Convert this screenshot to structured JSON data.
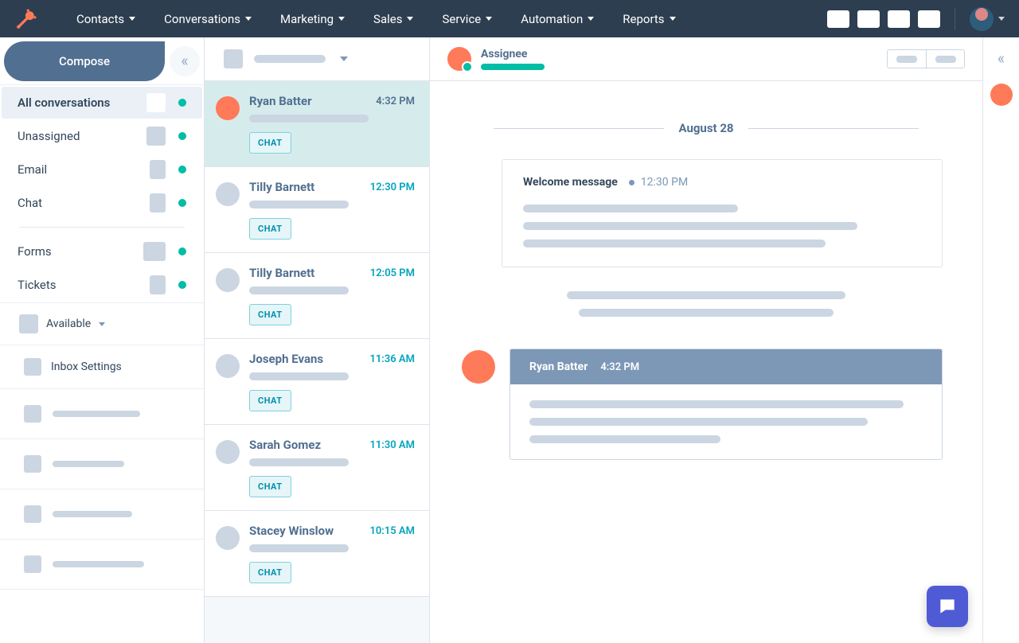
{
  "nav": {
    "items": [
      "Contacts",
      "Conversations",
      "Marketing",
      "Sales",
      "Service",
      "Automation",
      "Reports"
    ]
  },
  "compose_label": "Compose",
  "filters": {
    "all": "All conversations",
    "unassigned": "Unassigned",
    "email": "Email",
    "chat": "Chat",
    "forms": "Forms",
    "tickets": "Tickets"
  },
  "availability_label": "Available",
  "inbox_settings_label": "Inbox Settings",
  "conversations": [
    {
      "name": "Ryan Batter",
      "time": "4:32 PM",
      "badge": "CHAT",
      "unread": false,
      "avatar": "orange",
      "selected": true,
      "preview_w": 150
    },
    {
      "name": "Tilly Barnett",
      "time": "12:30 PM",
      "badge": "CHAT",
      "unread": true,
      "avatar": "grey",
      "selected": false,
      "preview_w": 125
    },
    {
      "name": "Tilly Barnett",
      "time": "12:05 PM",
      "badge": "CHAT",
      "unread": true,
      "avatar": "grey",
      "selected": false,
      "preview_w": 125
    },
    {
      "name": "Joseph Evans",
      "time": "11:36 AM",
      "badge": "CHAT",
      "unread": true,
      "avatar": "grey",
      "selected": false,
      "preview_w": 125
    },
    {
      "name": "Sarah Gomez",
      "time": "11:30 AM",
      "badge": "CHAT",
      "unread": true,
      "avatar": "grey",
      "selected": false,
      "preview_w": 125
    },
    {
      "name": "Stacey Winslow",
      "time": "10:15 AM",
      "badge": "CHAT",
      "unread": true,
      "avatar": "grey",
      "selected": false,
      "preview_w": 125
    }
  ],
  "thread": {
    "assignee_label": "Assignee",
    "date_label": "August 28",
    "welcome_title": "Welcome message",
    "welcome_time": "12:30 PM",
    "reply_name": "Ryan Batter",
    "reply_time": "4:32 PM"
  },
  "colors": {
    "accent_orange": "#ff7a59",
    "accent_teal": "#00bda5",
    "chat_widget": "#4f5bd5"
  }
}
